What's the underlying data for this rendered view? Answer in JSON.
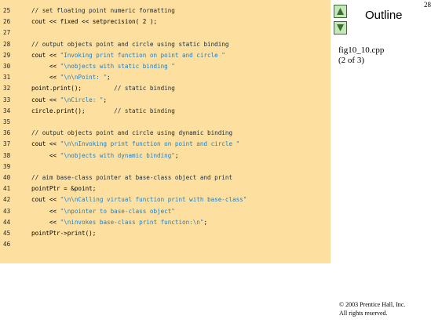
{
  "slide": {
    "page_number": "28",
    "outline_title": "Outline",
    "file_name": "fig10_10.cpp",
    "part": "(2 of 3)",
    "copyright_line1": "© 2003 Prentice Hall, Inc.",
    "copyright_line2": "All rights reserved."
  },
  "colors": {
    "panel_background": "#fde0a0",
    "comment_text": "#1a2a3a",
    "string_literal": "#1c7ec8",
    "nav_button_fill": "#c6e7b8",
    "nav_button_border": "#3c6e34"
  },
  "nav": {
    "up_icon": "triangle-up-icon",
    "down_icon": "triangle-down-icon"
  },
  "code_lines": [
    {
      "num": "25",
      "segments": [
        {
          "t": "comment",
          "s": "// set floating point numeric formatting"
        }
      ]
    },
    {
      "num": "26",
      "segments": [
        {
          "t": "code",
          "s": "cout << fixed << setprecision( 2 );"
        }
      ]
    },
    {
      "num": "27",
      "segments": []
    },
    {
      "num": "28",
      "segments": [
        {
          "t": "comment",
          "s": "// output objects point and circle using static binding"
        }
      ]
    },
    {
      "num": "29",
      "segments": [
        {
          "t": "code",
          "s": "cout << "
        },
        {
          "t": "string",
          "s": "\"Invoking print function on point and circle \""
        }
      ]
    },
    {
      "num": "30",
      "segments": [
        {
          "t": "code",
          "s": "     << "
        },
        {
          "t": "string",
          "s": "\"\\nobjects with static binding \""
        }
      ]
    },
    {
      "num": "31",
      "segments": [
        {
          "t": "code",
          "s": "     << "
        },
        {
          "t": "string",
          "s": "\"\\n\\nPoint: \""
        },
        {
          "t": "code",
          "s": ";"
        }
      ]
    },
    {
      "num": "32",
      "segments": [
        {
          "t": "code",
          "s": "point.print();         "
        },
        {
          "t": "comment",
          "s": "// static binding"
        }
      ]
    },
    {
      "num": "33",
      "segments": [
        {
          "t": "code",
          "s": "cout << "
        },
        {
          "t": "string",
          "s": "\"\\nCircle: \""
        },
        {
          "t": "code",
          "s": ";"
        }
      ]
    },
    {
      "num": "34",
      "segments": [
        {
          "t": "code",
          "s": "circle.print();        "
        },
        {
          "t": "comment",
          "s": "// static binding"
        }
      ]
    },
    {
      "num": "35",
      "segments": []
    },
    {
      "num": "36",
      "segments": [
        {
          "t": "comment",
          "s": "// output objects point and circle using dynamic binding"
        }
      ]
    },
    {
      "num": "37",
      "segments": [
        {
          "t": "code",
          "s": "cout << "
        },
        {
          "t": "string",
          "s": "\"\\n\\nInvoking print function on point and circle \""
        }
      ]
    },
    {
      "num": "38",
      "segments": [
        {
          "t": "code",
          "s": "     << "
        },
        {
          "t": "string",
          "s": "\"\\nobjects with dynamic binding\""
        },
        {
          "t": "code",
          "s": ";"
        }
      ]
    },
    {
      "num": "39",
      "segments": []
    },
    {
      "num": "40",
      "segments": [
        {
          "t": "comment",
          "s": "// aim base-class pointer at base-class object and print"
        }
      ]
    },
    {
      "num": "41",
      "segments": [
        {
          "t": "code",
          "s": "pointPtr = &point;"
        }
      ]
    },
    {
      "num": "42",
      "segments": [
        {
          "t": "code",
          "s": "cout << "
        },
        {
          "t": "string",
          "s": "\"\\n\\nCalling virtual function print with base-class\""
        }
      ]
    },
    {
      "num": "43",
      "segments": [
        {
          "t": "code",
          "s": "     << "
        },
        {
          "t": "string",
          "s": "\"\\npointer to base-class object\""
        }
      ]
    },
    {
      "num": "44",
      "segments": [
        {
          "t": "code",
          "s": "     << "
        },
        {
          "t": "string",
          "s": "\"\\ninvokes base-class print function:\\n\""
        },
        {
          "t": "code",
          "s": ";"
        }
      ]
    },
    {
      "num": "45",
      "segments": [
        {
          "t": "code",
          "s": "pointPtr->print();"
        }
      ]
    },
    {
      "num": "46",
      "segments": []
    }
  ]
}
